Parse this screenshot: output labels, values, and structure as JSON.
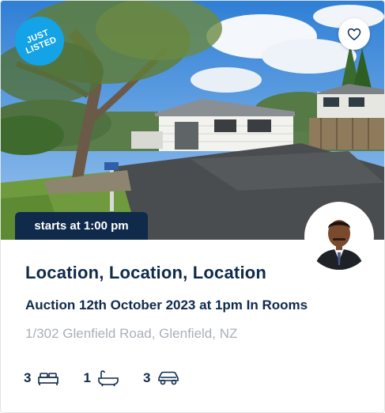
{
  "listing": {
    "badge_line1": "JUST",
    "badge_line2": "LISTED",
    "start_time": "starts at 1:00 pm",
    "title": "Location, Location, Location",
    "auction": "Auction 12th October 2023 at 1pm In Rooms",
    "address": "1/302 Glenfield Road, Glenfield, NZ"
  },
  "features": {
    "bedrooms": "3",
    "bathrooms": "1",
    "parking": "3"
  },
  "icons": {
    "favorite": "heart-icon",
    "bed": "bed-icon",
    "bath": "bath-icon",
    "car": "car-icon"
  },
  "colors": {
    "navy": "#0f2a4a",
    "badge_blue": "#14a3e6",
    "address_grey": "#a9b0b8"
  }
}
